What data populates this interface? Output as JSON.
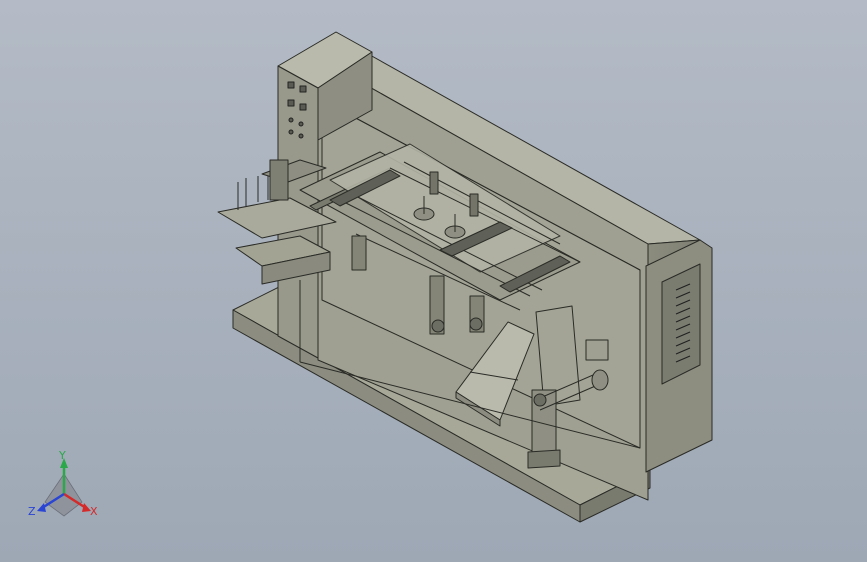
{
  "view_triad": {
    "axis_x": "X",
    "axis_y": "Y",
    "axis_z": "Z",
    "colors": {
      "x": "#d42a2a",
      "y": "#2aa84a",
      "z": "#2a44d4"
    }
  },
  "model": {
    "body_color": "#9a9b8c",
    "body_dark": "#6f7066",
    "body_light": "#b7b8a9",
    "edge_color": "#2a2b26"
  }
}
